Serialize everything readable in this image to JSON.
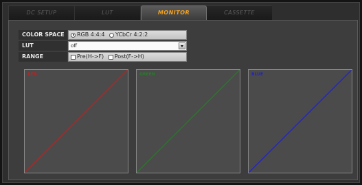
{
  "tabs": [
    {
      "label": "DC SETUP",
      "active": false
    },
    {
      "label": "LUT",
      "active": false
    },
    {
      "label": "MONITOR",
      "active": true
    },
    {
      "label": "CASSETTE",
      "active": false
    }
  ],
  "color_space": {
    "label": "COLOR SPACE",
    "options": [
      {
        "label": "RGB 4:4:4",
        "selected": true
      },
      {
        "label": "YCbCr 4:2:2",
        "selected": false
      }
    ]
  },
  "lut": {
    "label": "LUT",
    "value": "off"
  },
  "range": {
    "label": "RANGE",
    "options": [
      {
        "label": "Pre(H->F)",
        "checked": false
      },
      {
        "label": "Post(F->H)",
        "checked": false
      }
    ]
  },
  "graphs": [
    {
      "title": "RED",
      "color": "#c02020"
    },
    {
      "title": "GREEN",
      "color": "#2a7a2a"
    },
    {
      "title": "BLUE",
      "color": "#2020d0"
    }
  ],
  "colors": {
    "active_tab": "#f0a020"
  }
}
